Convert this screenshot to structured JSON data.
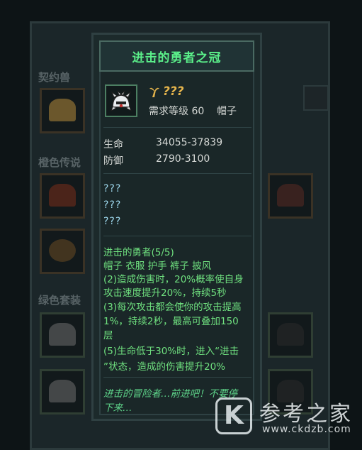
{
  "background": {
    "sections": [
      "契约兽",
      "橙色传说",
      "绿色套装"
    ]
  },
  "tooltip": {
    "title": "进击的勇者之冠",
    "item": {
      "name": "???",
      "requirement": "需求等级 60",
      "slot_type": "帽子",
      "icon": "spiked-helmet-icon"
    },
    "stats": [
      {
        "label": "生命",
        "value": "34055-37839"
      },
      {
        "label": "防御",
        "value": "2790-3100"
      }
    ],
    "unknown_lines": [
      "???",
      "???",
      "???"
    ],
    "set_bonus": {
      "header": "进击的勇者(5/5)",
      "pieces": "帽子 衣服 护手 裤子 披风",
      "lines": [
        "(2)造成伤害时，20%概率使自身",
        "攻击速度提升20%，持续5秒",
        "(3)每次攻击都会使你的攻击提高",
        "1%，持续2秒，最高可叠加150",
        "层",
        "(5)生命低于30%时，进入“进击",
        "”状态，造成的伤害提升20%"
      ]
    },
    "flavor": [
      "进击的冒险者…前进吧！不要停",
      "下来…"
    ]
  },
  "watermark": {
    "logo": "K",
    "name": "参考之家",
    "url": "www.ckdzb.com"
  },
  "colors": {
    "title_green": "#5bf08a",
    "item_name_gold": "#e3b34c",
    "unknown_blue": "#9fd9ee",
    "set_green": "#6fe07f"
  }
}
